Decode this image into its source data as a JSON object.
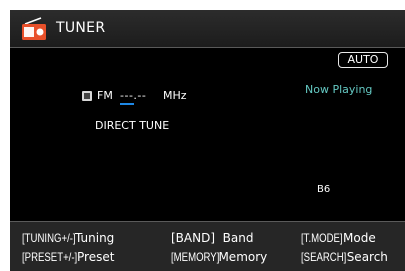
{
  "header": {
    "title": "TUNER",
    "icon": "radio-icon"
  },
  "status": {
    "mode_badge": "AUTO",
    "now_playing": "Now Playing"
  },
  "tuner": {
    "band": "FM",
    "frequency": "---.--",
    "unit": "MHz",
    "entry_mode": "DIRECT TUNE",
    "preset_channel": "B6"
  },
  "footer": {
    "hints": [
      {
        "key": "[TUNING+/-]",
        "action": "Tuning"
      },
      {
        "key": "[BAND]",
        "action": "Band"
      },
      {
        "key": "[T.MODE]",
        "action": "Mode"
      },
      {
        "key": "[PRESET+/-]",
        "action": "Preset"
      },
      {
        "key": "[MEMORY]",
        "action": "Memory"
      },
      {
        "key": "[SEARCH]",
        "action": "Search"
      }
    ]
  },
  "colors": {
    "accent": "#64c8c2",
    "cursor": "#1e88e5",
    "background": "#000000"
  }
}
